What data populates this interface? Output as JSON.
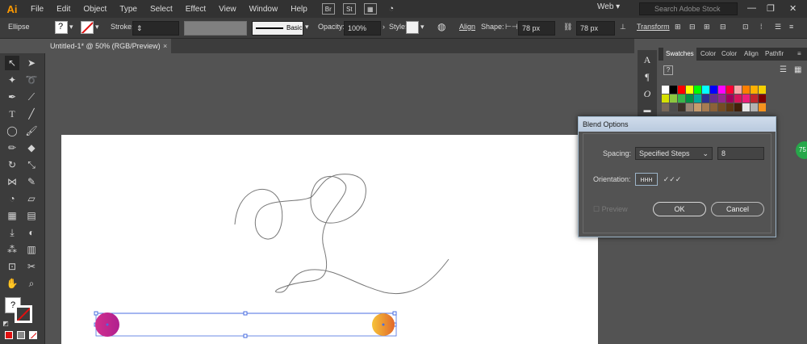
{
  "app": {
    "logo": "Ai"
  },
  "menu": [
    "File",
    "Edit",
    "Object",
    "Type",
    "Select",
    "Effect",
    "View",
    "Window",
    "Help"
  ],
  "menubar_icons": [
    "Br",
    "St"
  ],
  "workspace": "Web",
  "search": {
    "placeholder": "Search Adobe Stock"
  },
  "control": {
    "tool_name": "Ellipse",
    "stroke_label": "Stroke:",
    "basic": "Basic",
    "opacity_label": "Opacity:",
    "opacity_value": "100%",
    "style_label": "Style:",
    "align": "Align",
    "shape_label": "Shape:",
    "width": "78 px",
    "height": "78 px",
    "transform": "Transform"
  },
  "document": {
    "tab": "Untitled-1* @ 50% (RGB/Preview)",
    "close": "×"
  },
  "swatches": {
    "tabs": [
      "Swatches",
      "Color",
      "Color",
      "Align",
      "Pathfir"
    ],
    "help": "?",
    "row1": [
      "#ffffff",
      "#000000",
      "#ff0000",
      "#ffff00",
      "#00ff00",
      "#00ffff",
      "#0000ff",
      "#ff00ff",
      "#ff0033",
      "#f7a8a8",
      "#ff7f00",
      "#ffb000",
      "#f5d000"
    ],
    "row2": [
      "#d6e000",
      "#8cc63f",
      "#39b54a",
      "#009245",
      "#00a99d",
      "#2e3192",
      "#662d91",
      "#93278f",
      "#9e005d",
      "#d4145a",
      "#ed1e79",
      "#c1272d",
      "#7f0000"
    ],
    "row3": [
      "#7a6a5a",
      "#4d4d4d",
      "#3c3228",
      "#998675",
      "#c69c6d",
      "#a67c52",
      "#8c6239",
      "#754c24",
      "#603813",
      "#42210b",
      "#e6e6e6",
      "#b3b3b3",
      "#f7931e"
    ]
  },
  "dialog": {
    "title": "Blend Options",
    "spacing_label": "Spacing:",
    "spacing_value": "Specified Steps",
    "steps": "8",
    "orientation_label": "Orientation:",
    "preview_label": "Preview",
    "ok": "OK",
    "cancel": "Cancel"
  },
  "badge": "75"
}
